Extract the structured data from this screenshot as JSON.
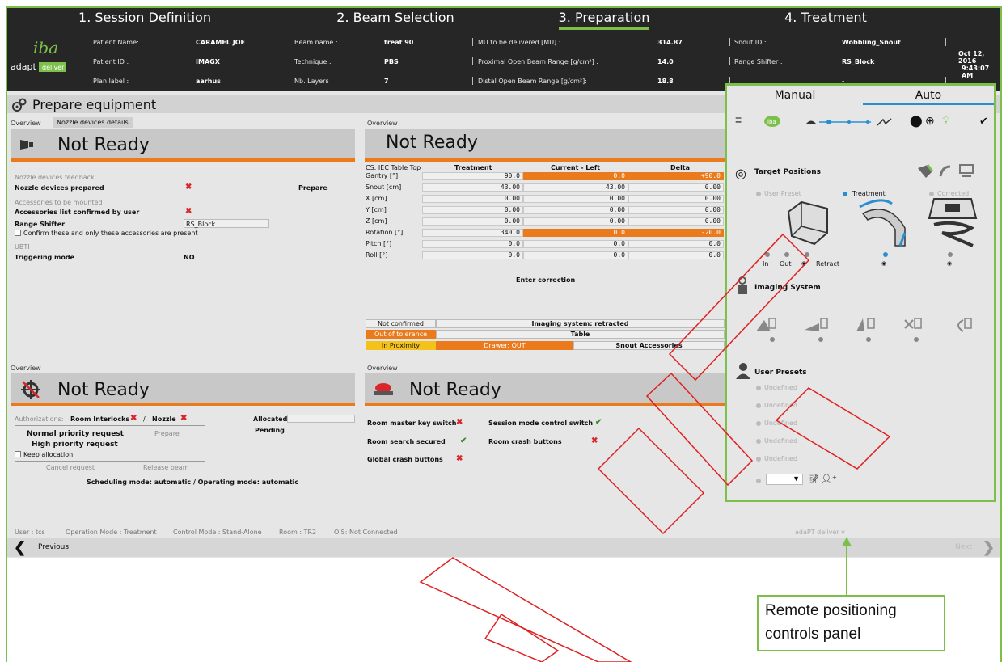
{
  "steps": [
    "1. Session Definition",
    "2. Beam Selection",
    "3. Preparation",
    "4. Treatment"
  ],
  "header": {
    "patient_name_label": "Patient Name:",
    "patient_name": "CARAMEL JOE",
    "patient_id_label": "Patient ID :",
    "patient_id": "IMAGX",
    "plan_label_label": "Plan label :",
    "plan_label": "aarhus",
    "beam_name_label": "Beam name :",
    "beam_name": "treat 90",
    "technique_label": "Technique :",
    "technique": "PBS",
    "layers_label": "Nb. Layers :",
    "layers": "7",
    "mu_label": "MU to be delivered [MU] :",
    "mu": "314.87",
    "prox_label": "Proximal Open Beam Range [g/cm²] :",
    "prox": "14.0",
    "dist_label": "Distal Open Beam Range [g/cm²]:",
    "dist": "18.8",
    "snout_label": "Snout ID :",
    "snout": "Wobbling_Snout",
    "shifter_label": "Range Shifter :",
    "shifter": "RS_Block",
    "blank_value": "-",
    "date": "Oct 12, 2016",
    "time": "9:43:07 AM"
  },
  "logo": {
    "brand": "iba",
    "product": "adapt",
    "suffix": "deliver"
  },
  "page_title": "Prepare equipment",
  "nozzle": {
    "tab_overview": "Overview",
    "tab_details": "Nozzle devices details",
    "status": "Not Ready",
    "feedback_hdr": "Nozzle devices feedback",
    "prepared_label": "Nozzle devices prepared",
    "prepare_btn": "Prepare",
    "acc_hdr": "Accessories to be mounted",
    "acc_confirmed": "Accessories list confirmed by user",
    "range_shifter_label": "Range Shifter",
    "range_shifter_value": "RS_Block",
    "confirm_text": "Confirm these and only these accessories are present",
    "ubti": "UBTI",
    "trigger_label": "Triggering mode",
    "trigger_value": "NO"
  },
  "table": {
    "overview": "Overview",
    "status": "Not Ready",
    "cs": "CS: IEC Table Top",
    "col_treat": "Treatment",
    "col_cur": "Current - Left",
    "col_delta": "Delta",
    "rows": [
      {
        "name": "Gantry [°]",
        "t": "90.0",
        "c": "0.0",
        "d": "+90.0",
        "hl": true
      },
      {
        "name": "Snout [cm]",
        "t": "43.00",
        "c": "43.00",
        "d": "0.00",
        "hl": false
      },
      {
        "name": "X [cm]",
        "t": "0.00",
        "c": "0.00",
        "d": "0.00",
        "hl": false
      },
      {
        "name": "Y [cm]",
        "t": "0.00",
        "c": "0.00",
        "d": "0.00",
        "hl": false
      },
      {
        "name": "Z [cm]",
        "t": "0.00",
        "c": "0.00",
        "d": "0.00",
        "hl": false
      },
      {
        "name": "Rotation [°]",
        "t": "340.0",
        "c": "0.0",
        "d": "-20.0",
        "hl": true
      },
      {
        "name": "Pitch [°]",
        "t": "0.0",
        "c": "0.0",
        "d": "0.0",
        "hl": false
      },
      {
        "name": "Roll [°]",
        "t": "0.0",
        "c": "0.0",
        "d": "0.0",
        "hl": false
      }
    ],
    "enter_correction": "Enter correction",
    "s_not_confirmed": "Not confirmed",
    "s_imaging": "Imaging system: retracted",
    "s_out_tol": "Out of tolerance",
    "s_table": "Table",
    "s_prox": "In Proximity",
    "s_drawer": "Drawer: OUT",
    "s_snout_acc": "Snout Accessories"
  },
  "beam": {
    "overview": "Overview",
    "status": "Not Ready",
    "auth_label": "Authorizations:",
    "room_interlocks": "Room Interlocks",
    "slash": "/",
    "nozzle": "Nozzle",
    "allocated": "Allocated",
    "pending": "Pending",
    "normal": "Normal priority request",
    "high": "High priority request",
    "prepare": "Prepare",
    "keep": "Keep allocation",
    "cancel": "Cancel request",
    "release": "Release beam",
    "mode": "Scheduling mode: automatic  /  Operating mode: automatic"
  },
  "room": {
    "overview": "Overview",
    "status": "Not Ready",
    "key": "Room master key switch",
    "search": "Room search secured",
    "global": "Global crash buttons",
    "session": "Session mode control switch",
    "crash": "Room crash buttons"
  },
  "statusbar": {
    "user": "User : tcs",
    "op": "Operation Mode : Treatment",
    "ctl": "Control Mode : Stand-Alone",
    "room": "Room : TR2",
    "ois": "OIS: Not Connected",
    "version": "adaPT deliver v"
  },
  "nav": {
    "previous": "Previous",
    "next": "Next"
  },
  "remote": {
    "tab_manual": "Manual",
    "tab_auto": "Auto",
    "target_positions": "Target Positions",
    "user_preset": "User Preset",
    "treatment": "Treatment",
    "corrected": "Corrected",
    "in": "In",
    "out": "Out",
    "retract": "Retract",
    "imaging": "Imaging System",
    "user_presets": "User Presets",
    "presets": [
      "Undefined",
      "Undefined",
      "Undefined",
      "Undefined",
      "Undefined"
    ]
  },
  "callout": {
    "line1": "Remote positioning",
    "line2": "controls panel"
  }
}
